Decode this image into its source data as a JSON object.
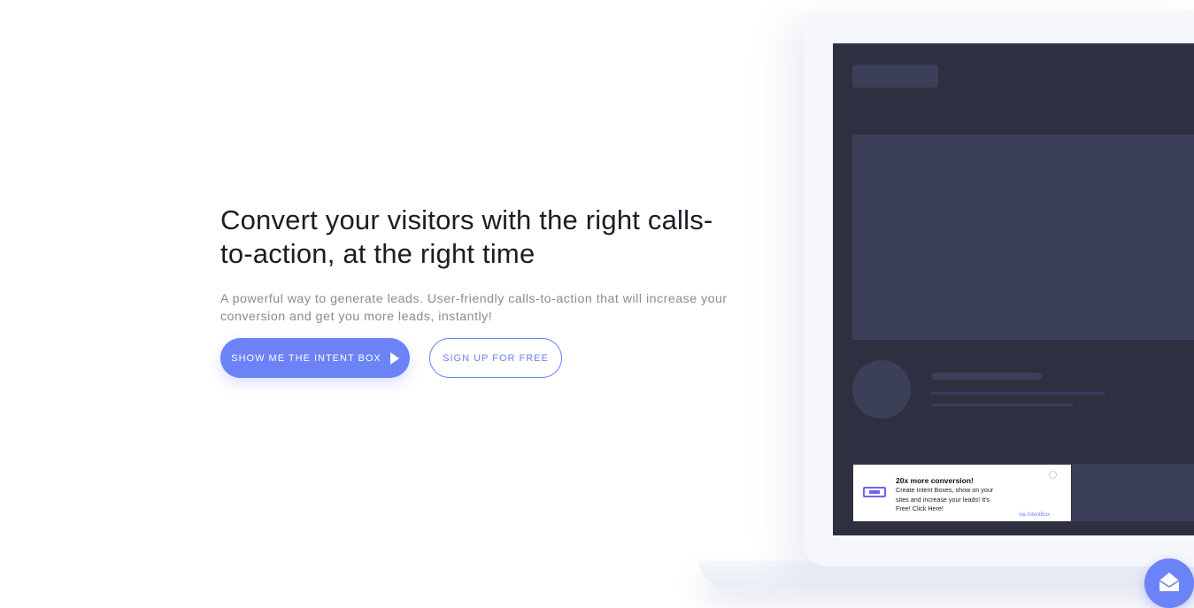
{
  "hero": {
    "headline_line1": "Convert your visitors with the right calls-",
    "headline_line2": "to-action, at the right time",
    "subtitle": "A powerful way to generate leads. User-friendly calls-to-action that will increase your conversion and get you more leads, instantly!"
  },
  "buttons": {
    "primary_label": "SHOW ME THE INTENT BOX",
    "primary_icon": "play-icon",
    "secondary_label": "SIGN UP FOR FREE"
  },
  "mockup": {
    "popup_title": "20x more conversion!",
    "popup_body": "Create Intent Boxes, show on your sites and increase your leads! It's Free! Click Here!",
    "popup_brand": "via IntentBox"
  },
  "chat_widget": {
    "icon": "envelope-icon"
  },
  "colors": {
    "accent": "#6c82f7",
    "screen": "#2e3042",
    "skeleton": "#3c3f58"
  }
}
